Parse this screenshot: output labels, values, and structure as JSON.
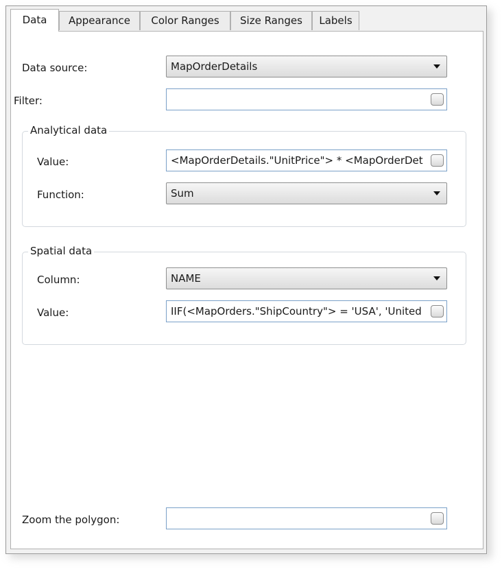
{
  "tabs": [
    {
      "label": "Data",
      "active": true
    },
    {
      "label": "Appearance",
      "active": false
    },
    {
      "label": "Color Ranges",
      "active": false
    },
    {
      "label": "Size Ranges",
      "active": false
    },
    {
      "label": "Labels",
      "active": false
    }
  ],
  "form": {
    "data_source": {
      "label": "Data source:",
      "value": "MapOrderDetails"
    },
    "filter": {
      "label": "Filter:",
      "value": ""
    },
    "analytical": {
      "title": "Analytical data",
      "value": {
        "label": "Value:",
        "value": "<MapOrderDetails.\"UnitPrice\"> * <MapOrderDetails.\"Quantity\">"
      },
      "function": {
        "label": "Function:",
        "value": "Sum"
      }
    },
    "spatial": {
      "title": "Spatial data",
      "column": {
        "label": "Column:",
        "value": "NAME"
      },
      "value": {
        "label": "Value:",
        "value": "IIF(<MapOrders.\"ShipCountry\"> = 'USA', 'United States', <MapOrders.\"ShipCountry\">)"
      }
    },
    "zoom": {
      "label": "Zoom the polygon:",
      "value": ""
    }
  },
  "icons": {
    "dropdown": "chevron-down-icon",
    "ellipsis": "ellipsis-button-icon"
  }
}
